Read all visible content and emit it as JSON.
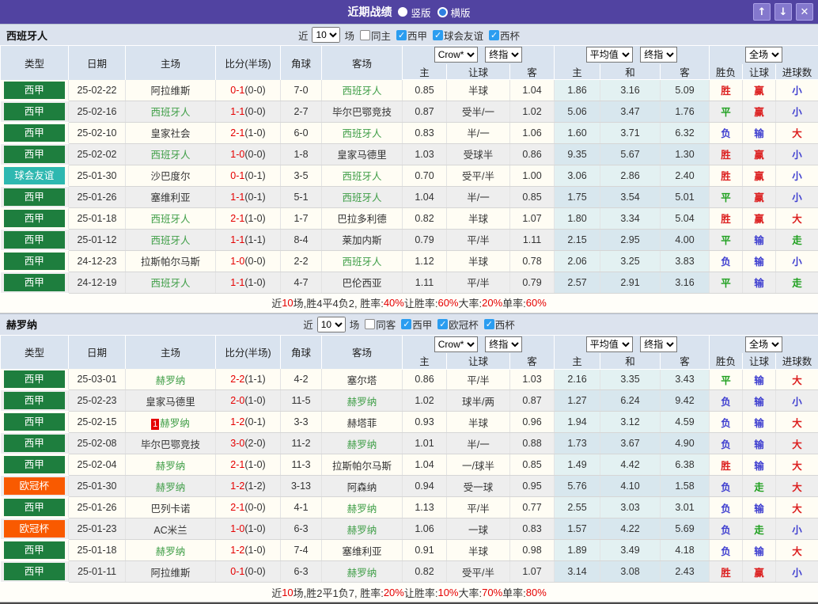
{
  "topbar": {
    "title": "近期战绩",
    "radio_vertical": "竖版",
    "radio_horizontal": "横版",
    "icons": {
      "up": "↑",
      "down": "↓",
      "close": "✕"
    }
  },
  "filter": {
    "prefix": "近",
    "suffix": "场"
  },
  "table_header": {
    "cols": [
      "类型",
      "日期",
      "主场",
      "比分(半场)",
      "角球",
      "客场"
    ],
    "sub": [
      "主",
      "让球",
      "客",
      "主",
      "和",
      "客",
      "胜负",
      "让球",
      "进球数"
    ],
    "dd_crow": "Crow*",
    "dd_final1": "终指",
    "dd_avg": "平均值",
    "dd_final2": "终指",
    "dd_full": "全场"
  },
  "colors": {
    "type": {
      "西甲": "#1e7e3e",
      "球会友谊": "#2eb8b0",
      "欧冠杯": "#f95a00"
    },
    "focal_team": "#3f9e47",
    "opponent_team": "#333333",
    "score_red": "#e50000",
    "result": {
      "胜": "#dc2020",
      "赢": "#dc2020",
      "大": "#dc2020",
      "平": "#1fa01f",
      "走": "#1fa01f",
      "负": "#4040d0",
      "输": "#4040d0",
      "小": "#4040d0"
    }
  },
  "sections": [
    {
      "team": "西班牙人",
      "recent_count": "10",
      "filters": [
        {
          "label": "同主",
          "checked": false
        },
        {
          "label": "西甲",
          "checked": true
        },
        {
          "label": "球会友谊",
          "checked": true
        },
        {
          "label": "西杯",
          "checked": true
        }
      ],
      "rows": [
        {
          "type": "西甲",
          "date": "25-02-22",
          "home": "阿拉维斯",
          "home_focal": false,
          "home_badge": "",
          "score": "0-1",
          "half": "(0-0)",
          "corner": "7-0",
          "away": "西班牙人",
          "away_focal": true,
          "odds": [
            "0.85",
            "半球",
            "1.04",
            "1.86",
            "3.16",
            "5.09"
          ],
          "results": [
            "胜",
            "赢",
            "小"
          ]
        },
        {
          "type": "西甲",
          "date": "25-02-16",
          "home": "西班牙人",
          "home_focal": true,
          "home_badge": "",
          "score": "1-1",
          "half": "(0-0)",
          "corner": "2-7",
          "away": "毕尔巴鄂竞技",
          "away_focal": false,
          "odds": [
            "0.87",
            "受半/一",
            "1.02",
            "5.06",
            "3.47",
            "1.76"
          ],
          "results": [
            "平",
            "赢",
            "小"
          ]
        },
        {
          "type": "西甲",
          "date": "25-02-10",
          "home": "皇家社会",
          "home_focal": false,
          "home_badge": "",
          "score": "2-1",
          "half": "(1-0)",
          "corner": "6-0",
          "away": "西班牙人",
          "away_focal": true,
          "odds": [
            "0.83",
            "半/一",
            "1.06",
            "1.60",
            "3.71",
            "6.32"
          ],
          "results": [
            "负",
            "输",
            "大"
          ]
        },
        {
          "type": "西甲",
          "date": "25-02-02",
          "home": "西班牙人",
          "home_focal": true,
          "home_badge": "",
          "score": "1-0",
          "half": "(0-0)",
          "corner": "1-8",
          "away": "皇家马德里",
          "away_focal": false,
          "odds": [
            "1.03",
            "受球半",
            "0.86",
            "9.35",
            "5.67",
            "1.30"
          ],
          "results": [
            "胜",
            "赢",
            "小"
          ]
        },
        {
          "type": "球会友谊",
          "date": "25-01-30",
          "home": "沙巴度尔",
          "home_focal": false,
          "home_badge": "",
          "score": "0-1",
          "half": "(0-1)",
          "corner": "3-5",
          "away": "西班牙人",
          "away_focal": true,
          "odds": [
            "0.70",
            "受平/半",
            "1.00",
            "3.06",
            "2.86",
            "2.40"
          ],
          "results": [
            "胜",
            "赢",
            "小"
          ]
        },
        {
          "type": "西甲",
          "date": "25-01-26",
          "home": "塞维利亚",
          "home_focal": false,
          "home_badge": "",
          "score": "1-1",
          "half": "(0-1)",
          "corner": "5-1",
          "away": "西班牙人",
          "away_focal": true,
          "odds": [
            "1.04",
            "半/一",
            "0.85",
            "1.75",
            "3.54",
            "5.01"
          ],
          "results": [
            "平",
            "赢",
            "小"
          ]
        },
        {
          "type": "西甲",
          "date": "25-01-18",
          "home": "西班牙人",
          "home_focal": true,
          "home_badge": "",
          "score": "2-1",
          "half": "(1-0)",
          "corner": "1-7",
          "away": "巴拉多利德",
          "away_focal": false,
          "odds": [
            "0.82",
            "半球",
            "1.07",
            "1.80",
            "3.34",
            "5.04"
          ],
          "results": [
            "胜",
            "赢",
            "大"
          ]
        },
        {
          "type": "西甲",
          "date": "25-01-12",
          "home": "西班牙人",
          "home_focal": true,
          "home_badge": "",
          "score": "1-1",
          "half": "(1-1)",
          "corner": "8-4",
          "away": "莱加内斯",
          "away_focal": false,
          "odds": [
            "0.79",
            "平/半",
            "1.11",
            "2.15",
            "2.95",
            "4.00"
          ],
          "results": [
            "平",
            "输",
            "走"
          ]
        },
        {
          "type": "西甲",
          "date": "24-12-23",
          "home": "拉斯帕尔马斯",
          "home_focal": false,
          "home_badge": "",
          "score": "1-0",
          "half": "(0-0)",
          "corner": "2-2",
          "away": "西班牙人",
          "away_focal": true,
          "odds": [
            "1.12",
            "半球",
            "0.78",
            "2.06",
            "3.25",
            "3.83"
          ],
          "results": [
            "负",
            "输",
            "小"
          ]
        },
        {
          "type": "西甲",
          "date": "24-12-19",
          "home": "西班牙人",
          "home_focal": true,
          "home_badge": "",
          "score": "1-1",
          "half": "(1-0)",
          "corner": "4-7",
          "away": "巴伦西亚",
          "away_focal": false,
          "odds": [
            "1.11",
            "平/半",
            "0.79",
            "2.57",
            "2.91",
            "3.16"
          ],
          "results": [
            "平",
            "输",
            "走"
          ]
        }
      ],
      "summary": [
        {
          "text": "近",
          "red": false
        },
        {
          "text": "10",
          "red": true
        },
        {
          "text": "场,胜4平4负2, 胜率:",
          "red": false
        },
        {
          "text": "40%",
          "red": true
        },
        {
          "text": " 让胜率:",
          "red": false
        },
        {
          "text": "60%",
          "red": true
        },
        {
          "text": " 大率:",
          "red": false
        },
        {
          "text": "20%",
          "red": true
        },
        {
          "text": " 单率:",
          "red": false
        },
        {
          "text": "60%",
          "red": true
        }
      ]
    },
    {
      "team": "赫罗纳",
      "recent_count": "10",
      "filters": [
        {
          "label": "同客",
          "checked": false
        },
        {
          "label": "西甲",
          "checked": true
        },
        {
          "label": "欧冠杯",
          "checked": true
        },
        {
          "label": "西杯",
          "checked": true
        }
      ],
      "rows": [
        {
          "type": "西甲",
          "date": "25-03-01",
          "home": "赫罗纳",
          "home_focal": true,
          "home_badge": "",
          "score": "2-2",
          "half": "(1-1)",
          "corner": "4-2",
          "away": "塞尔塔",
          "away_focal": false,
          "odds": [
            "0.86",
            "平/半",
            "1.03",
            "2.16",
            "3.35",
            "3.43"
          ],
          "results": [
            "平",
            "输",
            "大"
          ]
        },
        {
          "type": "西甲",
          "date": "25-02-23",
          "home": "皇家马德里",
          "home_focal": false,
          "home_badge": "",
          "score": "2-0",
          "half": "(1-0)",
          "corner": "11-5",
          "away": "赫罗纳",
          "away_focal": true,
          "odds": [
            "1.02",
            "球半/两",
            "0.87",
            "1.27",
            "6.24",
            "9.42"
          ],
          "results": [
            "负",
            "输",
            "小"
          ]
        },
        {
          "type": "西甲",
          "date": "25-02-15",
          "home": "赫罗纳",
          "home_focal": true,
          "home_badge": "1",
          "score": "1-2",
          "half": "(0-1)",
          "corner": "3-3",
          "away": "赫塔菲",
          "away_focal": false,
          "odds": [
            "0.93",
            "半球",
            "0.96",
            "1.94",
            "3.12",
            "4.59"
          ],
          "results": [
            "负",
            "输",
            "大"
          ]
        },
        {
          "type": "西甲",
          "date": "25-02-08",
          "home": "毕尔巴鄂竞技",
          "home_focal": false,
          "home_badge": "",
          "score": "3-0",
          "half": "(2-0)",
          "corner": "11-2",
          "away": "赫罗纳",
          "away_focal": true,
          "odds": [
            "1.01",
            "半/一",
            "0.88",
            "1.73",
            "3.67",
            "4.90"
          ],
          "results": [
            "负",
            "输",
            "大"
          ]
        },
        {
          "type": "西甲",
          "date": "25-02-04",
          "home": "赫罗纳",
          "home_focal": true,
          "home_badge": "",
          "score": "2-1",
          "half": "(1-0)",
          "corner": "11-3",
          "away": "拉斯帕尔马斯",
          "away_focal": false,
          "odds": [
            "1.04",
            "一/球半",
            "0.85",
            "1.49",
            "4.42",
            "6.38"
          ],
          "results": [
            "胜",
            "输",
            "大"
          ]
        },
        {
          "type": "欧冠杯",
          "date": "25-01-30",
          "home": "赫罗纳",
          "home_focal": true,
          "home_badge": "",
          "score": "1-2",
          "half": "(1-2)",
          "corner": "3-13",
          "away": "阿森纳",
          "away_focal": false,
          "odds": [
            "0.94",
            "受一球",
            "0.95",
            "5.76",
            "4.10",
            "1.58"
          ],
          "results": [
            "负",
            "走",
            "大"
          ]
        },
        {
          "type": "西甲",
          "date": "25-01-26",
          "home": "巴列卡诺",
          "home_focal": false,
          "home_badge": "",
          "score": "2-1",
          "half": "(0-0)",
          "corner": "4-1",
          "away": "赫罗纳",
          "away_focal": true,
          "odds": [
            "1.13",
            "平/半",
            "0.77",
            "2.55",
            "3.03",
            "3.01"
          ],
          "results": [
            "负",
            "输",
            "大"
          ]
        },
        {
          "type": "欧冠杯",
          "date": "25-01-23",
          "home": "AC米兰",
          "home_focal": false,
          "home_badge": "",
          "score": "1-0",
          "half": "(1-0)",
          "corner": "6-3",
          "away": "赫罗纳",
          "away_focal": true,
          "odds": [
            "1.06",
            "一球",
            "0.83",
            "1.57",
            "4.22",
            "5.69"
          ],
          "results": [
            "负",
            "走",
            "小"
          ]
        },
        {
          "type": "西甲",
          "date": "25-01-18",
          "home": "赫罗纳",
          "home_focal": true,
          "home_badge": "",
          "score": "1-2",
          "half": "(1-0)",
          "corner": "7-4",
          "away": "塞维利亚",
          "away_focal": false,
          "odds": [
            "0.91",
            "半球",
            "0.98",
            "1.89",
            "3.49",
            "4.18"
          ],
          "results": [
            "负",
            "输",
            "大"
          ]
        },
        {
          "type": "西甲",
          "date": "25-01-11",
          "home": "阿拉维斯",
          "home_focal": false,
          "home_badge": "",
          "score": "0-1",
          "half": "(0-0)",
          "corner": "6-3",
          "away": "赫罗纳",
          "away_focal": true,
          "odds": [
            "0.82",
            "受平/半",
            "1.07",
            "3.14",
            "3.08",
            "2.43"
          ],
          "results": [
            "胜",
            "赢",
            "小"
          ]
        }
      ],
      "summary": [
        {
          "text": "近",
          "red": false
        },
        {
          "text": "10",
          "red": true
        },
        {
          "text": "场,胜2平1负7, 胜率:",
          "red": false
        },
        {
          "text": "20%",
          "red": true
        },
        {
          "text": " 让胜率:",
          "red": false
        },
        {
          "text": "10%",
          "red": true
        },
        {
          "text": " 大率:",
          "red": false
        },
        {
          "text": "70%",
          "red": true
        },
        {
          "text": " 单率:",
          "red": false
        },
        {
          "text": "80%",
          "red": true
        }
      ]
    }
  ]
}
